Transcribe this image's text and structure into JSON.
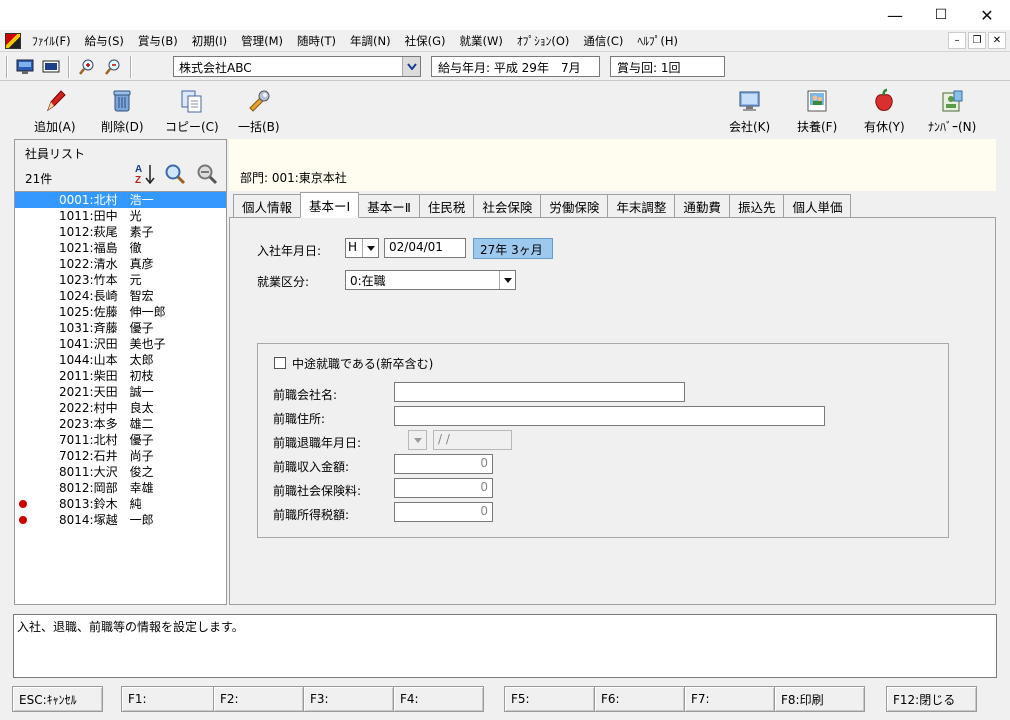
{
  "window": {
    "minimize_glyph": "—",
    "maximize_glyph": "☐",
    "close_glyph": "✕"
  },
  "menu": {
    "items": [
      "ﾌｧｲﾙ(F)",
      "給与(S)",
      "賞与(B)",
      "初期(I)",
      "管理(M)",
      "随時(T)",
      "年調(N)",
      "社保(G)",
      "就業(W)",
      "ｵﾌﾟｼｮﾝ(O)",
      "通信(C)",
      "ﾍﾙﾌﾟ(H)"
    ],
    "mdi_min": "–",
    "mdi_restore": "❐",
    "mdi_close": "✕"
  },
  "toolbar": {
    "company": "株式会社ABC",
    "pay_month_label": "給与年月: 平成 29年　7月",
    "bonus_round_label": "賞与回: 1回"
  },
  "actions": {
    "add": "追加(A)",
    "delete": "削除(D)",
    "copy": "コピー(C)",
    "bulk": "一括(B)",
    "company": "会社(K)",
    "dependents": "扶養(F)",
    "paid_leave": "有休(Y)",
    "number": "ﾅﾝﾊﾞｰ(N)"
  },
  "employee_list": {
    "title": "社員リスト",
    "count": "21件",
    "employees": [
      {
        "text": "0001:北村　浩一",
        "selected": true,
        "marked": false
      },
      {
        "text": "1011:田中　光",
        "selected": false,
        "marked": false
      },
      {
        "text": "1012:萩尾　素子",
        "selected": false,
        "marked": false
      },
      {
        "text": "1021:福島　徹",
        "selected": false,
        "marked": false
      },
      {
        "text": "1022:清水　真彦",
        "selected": false,
        "marked": false
      },
      {
        "text": "1023:竹本　元",
        "selected": false,
        "marked": false
      },
      {
        "text": "1024:長崎　智宏",
        "selected": false,
        "marked": false
      },
      {
        "text": "1025:佐藤　伸一郎",
        "selected": false,
        "marked": false
      },
      {
        "text": "1031:斉藤　優子",
        "selected": false,
        "marked": false
      },
      {
        "text": "1041:沢田　美也子",
        "selected": false,
        "marked": false
      },
      {
        "text": "1044:山本　太郎",
        "selected": false,
        "marked": false
      },
      {
        "text": "2011:柴田　初枝",
        "selected": false,
        "marked": false
      },
      {
        "text": "2021:天田　誠一",
        "selected": false,
        "marked": false
      },
      {
        "text": "2022:村中　良太",
        "selected": false,
        "marked": false
      },
      {
        "text": "2023:本多　雄二",
        "selected": false,
        "marked": false
      },
      {
        "text": "7011:北村　優子",
        "selected": false,
        "marked": false
      },
      {
        "text": "7012:石井　尚子",
        "selected": false,
        "marked": false
      },
      {
        "text": "8011:大沢　俊之",
        "selected": false,
        "marked": false
      },
      {
        "text": "8012:岡部　幸雄",
        "selected": false,
        "marked": false
      },
      {
        "text": "8013:鈴木　純",
        "selected": false,
        "marked": true
      },
      {
        "text": "8014:塚越　一郎",
        "selected": false,
        "marked": true
      }
    ]
  },
  "department": "部門:  001:東京本社",
  "tabs": [
    "個人情報",
    "基本ーⅠ",
    "基本ーⅡ",
    "住民税",
    "社会保険",
    "労働保険",
    "年末調整",
    "通勤費",
    "振込先",
    "個人単価"
  ],
  "active_tab": 1,
  "form": {
    "hire_date_label": "入社年月日:",
    "era": "H",
    "hire_date": "02/04/01",
    "tenure": "27年 3ヶ月",
    "employment_label": "就業区分:",
    "employment_value": "0:在職",
    "mid_career_label": "中途就職である(新卒含む)",
    "prev_company_label": "前職会社名:",
    "prev_address_label": "前職住所:",
    "prev_retire_label": "前職退職年月日:",
    "prev_retire_value": " /  /",
    "prev_income_label": "前職収入金額:",
    "prev_income_value": "0",
    "prev_social_label": "前職社会保険料:",
    "prev_social_value": "0",
    "prev_tax_label": "前職所得税額:",
    "prev_tax_value": "0"
  },
  "status_text": "入社、退職、前職等の情報を設定します。",
  "fkeys": {
    "esc": "ESC:ｷｬﾝｾﾙ",
    "f1": "F1:",
    "f2": "F2:",
    "f3": "F3:",
    "f4": "F4:",
    "f5": "F5:",
    "f6": "F6:",
    "f7": "F7:",
    "f8": "F8:印刷",
    "f12": "F12:閉じる"
  }
}
